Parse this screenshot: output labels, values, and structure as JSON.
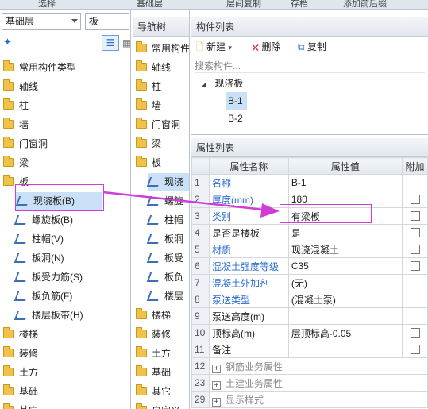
{
  "top_toolbar": {
    "items": [
      "选择",
      "基础层",
      "层间复制",
      "存档",
      "添加前后缀"
    ]
  },
  "left_panel": {
    "floor_select": "基础层",
    "category_select": "板",
    "tree": [
      {
        "label": "常用构件类型",
        "type": "folder"
      },
      {
        "label": "轴线",
        "type": "folder"
      },
      {
        "label": "柱",
        "type": "folder"
      },
      {
        "label": "墙",
        "type": "folder"
      },
      {
        "label": "门窗洞",
        "type": "folder"
      },
      {
        "label": "梁",
        "type": "folder"
      },
      {
        "label": "板",
        "type": "folder-open"
      },
      {
        "label": "现浇板(B)",
        "type": "child",
        "selected": true
      },
      {
        "label": "螺旋板(B)",
        "type": "child"
      },
      {
        "label": "柱帽(V)",
        "type": "child"
      },
      {
        "label": "板洞(N)",
        "type": "child"
      },
      {
        "label": "板受力筋(S)",
        "type": "child"
      },
      {
        "label": "板负筋(F)",
        "type": "child"
      },
      {
        "label": "楼层板带(H)",
        "type": "child"
      },
      {
        "label": "楼梯",
        "type": "folder"
      },
      {
        "label": "装修",
        "type": "folder"
      },
      {
        "label": "土方",
        "type": "folder"
      },
      {
        "label": "基础",
        "type": "folder"
      },
      {
        "label": "其它",
        "type": "folder"
      }
    ]
  },
  "nav_panel": {
    "title": "导航树",
    "items": [
      {
        "label": "常用构件",
        "type": "folder"
      },
      {
        "label": "轴线",
        "type": "folder"
      },
      {
        "label": "柱",
        "type": "folder"
      },
      {
        "label": "墙",
        "type": "folder"
      },
      {
        "label": "门窗洞",
        "type": "folder"
      },
      {
        "label": "梁",
        "type": "folder"
      },
      {
        "label": "板",
        "type": "folder"
      },
      {
        "label": "现浇",
        "type": "child",
        "selected": true
      },
      {
        "label": "螺旋",
        "type": "child"
      },
      {
        "label": "柱帽",
        "type": "child"
      },
      {
        "label": "板洞",
        "type": "child"
      },
      {
        "label": "板受",
        "type": "child"
      },
      {
        "label": "板负",
        "type": "child"
      },
      {
        "label": "楼层",
        "type": "child"
      },
      {
        "label": "楼梯",
        "type": "folder"
      },
      {
        "label": "装修",
        "type": "folder"
      },
      {
        "label": "土方",
        "type": "folder"
      },
      {
        "label": "基础",
        "type": "folder"
      },
      {
        "label": "其它",
        "type": "folder"
      },
      {
        "label": "自定义",
        "type": "folder"
      }
    ]
  },
  "component_list": {
    "title": "构件列表",
    "new_label": "新建",
    "delete_label": "删除",
    "copy_label": "复制",
    "search_placeholder": "搜索构件...",
    "group": "现浇板",
    "items": [
      "B-1",
      "B-2"
    ]
  },
  "property_list": {
    "title": "属性列表",
    "columns": [
      "属性名称",
      "属性值",
      "附加"
    ],
    "rows": [
      {
        "num": "1",
        "name": "名称",
        "value": "B-1",
        "style": "blue",
        "check": false
      },
      {
        "num": "2",
        "name": "厚度(mm)",
        "value": "180",
        "style": "blue",
        "check": true
      },
      {
        "num": "3",
        "name": "类别",
        "value": "有梁板",
        "style": "blue",
        "check": true
      },
      {
        "num": "4",
        "name": "是否是楼板",
        "value": "是",
        "style": "normal",
        "check": true
      },
      {
        "num": "5",
        "name": "材质",
        "value": "现浇混凝土",
        "style": "blue",
        "check": true
      },
      {
        "num": "6",
        "name": "混凝土强度等级",
        "value": "C35",
        "style": "blue",
        "check": true
      },
      {
        "num": "7",
        "name": "混凝土外加剂",
        "value": "(无)",
        "style": "blue",
        "check": false
      },
      {
        "num": "8",
        "name": "泵送类型",
        "value": "(混凝土泵)",
        "style": "blue",
        "check": false
      },
      {
        "num": "9",
        "name": "泵送高度(m)",
        "value": "",
        "style": "normal",
        "check": false
      },
      {
        "num": "10",
        "name": "顶标高(m)",
        "value": "层顶标高-0.05",
        "style": "normal",
        "check": true
      },
      {
        "num": "11",
        "name": "备注",
        "value": "",
        "style": "normal",
        "check": true
      },
      {
        "num": "12",
        "name": "钢筋业务属性",
        "value": "",
        "style": "group",
        "check": false
      },
      {
        "num": "23",
        "name": "土建业务属性",
        "value": "",
        "style": "group",
        "check": false
      },
      {
        "num": "29",
        "name": "显示样式",
        "value": "",
        "style": "group",
        "check": false
      }
    ]
  },
  "colors": {
    "selection": "#c9e0f7",
    "annotation": "#d23cd6",
    "blue_text": "#2a6bd1"
  }
}
